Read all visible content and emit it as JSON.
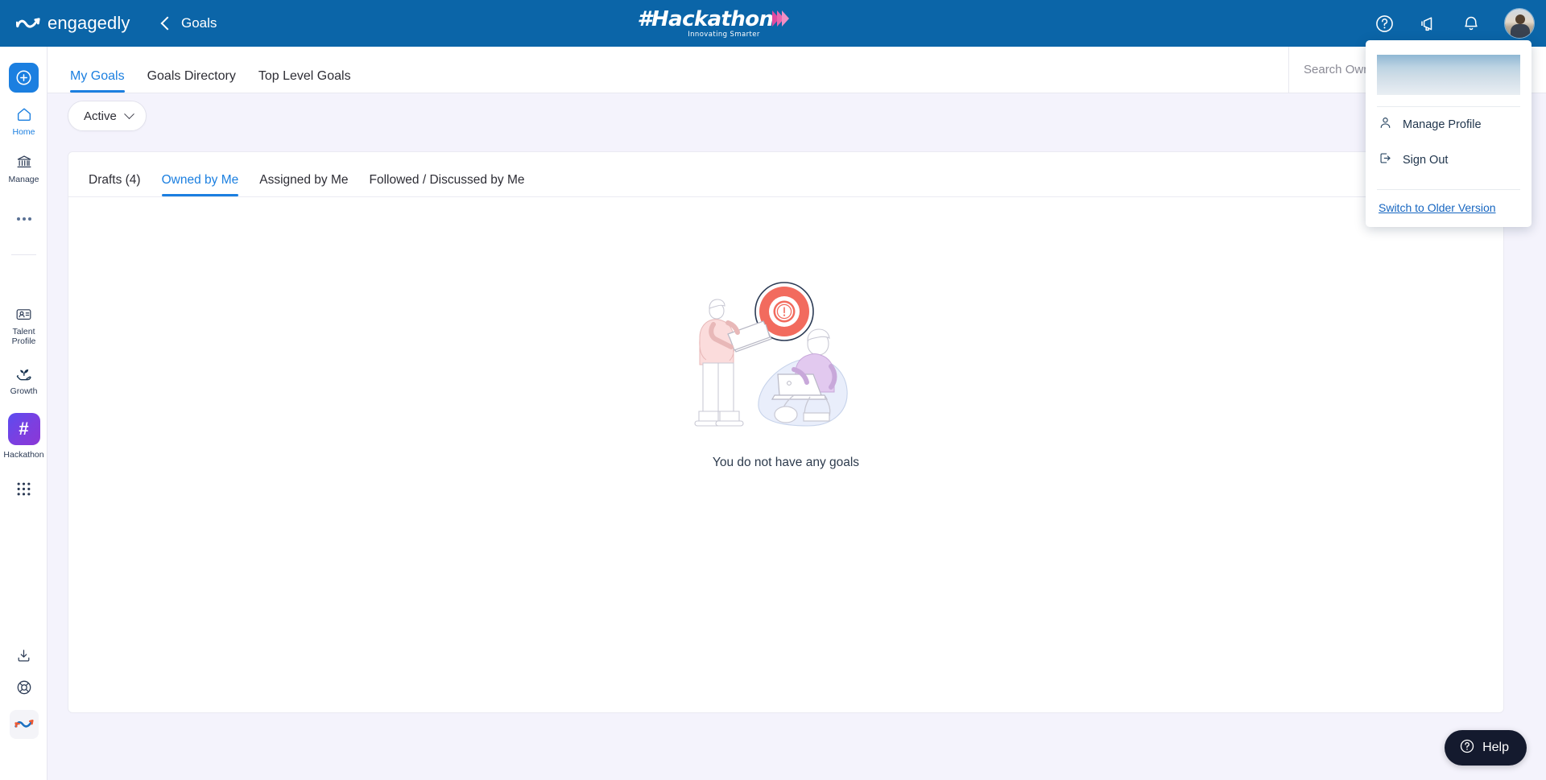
{
  "header": {
    "brand_name": "engagedly",
    "brand_logo_icon": "engagedly-swoosh-logo",
    "back_label": "Goals",
    "back_icon": "chevron-left-icon",
    "campaign_logo": {
      "word": "#Hackathon",
      "tagline": "Innovating Smarter",
      "chevron_icon": "triple-chevron-right-icon"
    },
    "actions": [
      {
        "name": "help-icon",
        "label": "Help"
      },
      {
        "name": "announcements-icon",
        "label": "Announcements"
      },
      {
        "name": "notifications-bell-icon",
        "label": "Notifications"
      }
    ],
    "avatar_label": "User profile"
  },
  "profile_menu": {
    "loading_placeholder": "",
    "items": [
      {
        "label": "Manage Profile",
        "icon": "user-icon"
      },
      {
        "label": "Sign Out",
        "icon": "logout-icon"
      }
    ],
    "footer_link": "Switch to Older Version"
  },
  "sidebar": {
    "add_button_icon": "plus-circle-icon",
    "items": [
      {
        "label": "Home",
        "icon": "home-icon",
        "active": true
      },
      {
        "label": "Manage",
        "icon": "bank-building-icon",
        "active": false
      },
      {
        "label": "",
        "icon": "more-dots-icon",
        "active": false
      },
      {
        "label": "Talent Profile",
        "icon": "id-badge-icon",
        "active": false
      },
      {
        "label": "Growth",
        "icon": "sprout-in-hand-icon",
        "active": false
      },
      {
        "label": "Hackathon",
        "icon": "hash-tile-icon",
        "active": false,
        "tile": "#"
      },
      {
        "label": "",
        "icon": "apps-grid-icon",
        "active": false
      }
    ],
    "bottom_items": [
      {
        "label": "",
        "icon": "download-icon"
      },
      {
        "label": "",
        "icon": "lifebuoy-support-icon"
      },
      {
        "label": "",
        "icon": "engagedly-mini-logo-icon"
      }
    ]
  },
  "tabs": [
    {
      "label": "My Goals",
      "active": true
    },
    {
      "label": "Goals Directory",
      "active": false
    },
    {
      "label": "Top Level Goals",
      "active": false
    }
  ],
  "search": {
    "placeholder": "Search Owner or Goal",
    "value": "",
    "icon": "search-icon"
  },
  "filter": {
    "label": "Active",
    "chevron_icon": "chevron-down-icon"
  },
  "subtabs": [
    {
      "label": "Drafts (4)",
      "active": false
    },
    {
      "label": "Owned by Me",
      "active": true
    },
    {
      "label": "Assigned by Me",
      "active": false
    },
    {
      "label": "Followed / Discussed by Me",
      "active": false
    }
  ],
  "empty_state": {
    "message": "You do not have any goals",
    "illustration": "two-people-with-laptops-and-alert-target-illustration"
  },
  "help_fab": {
    "label": "Help",
    "icon": "question-circle-icon"
  },
  "colors": {
    "header_blue": "#0b65a8",
    "accent_blue": "#1b7fe0",
    "page_bg": "#f4f3fc",
    "hackathon_purple": "#7c3fe0",
    "hackathon_pink": "#e0499f",
    "help_dark": "#141a2e",
    "illustration_coral": "#f26b5e"
  }
}
